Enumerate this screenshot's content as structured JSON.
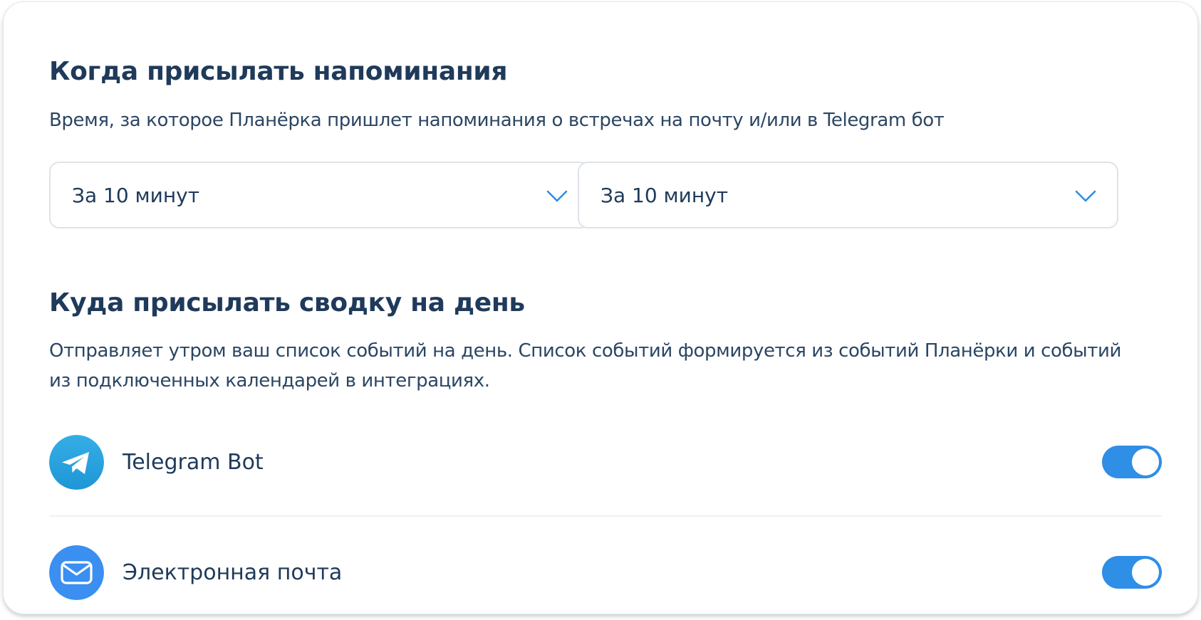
{
  "reminders": {
    "title": "Когда присылать напоминания",
    "subtitle": "Время, за которое Планёрка пришлет напоминания о встречах на почту и/или в Telegram бот",
    "selects": [
      {
        "value": "За 10 минут",
        "icon": "chevron-down-icon"
      },
      {
        "value": "За 10 минут",
        "icon": "chevron-down-icon"
      }
    ]
  },
  "digest": {
    "title": "Куда присылать сводку на день",
    "description": "Отправляет утром ваш список событий на день. Список событий формируется из событий Планёрки и событий из подключенных календарей в интеграциях.",
    "channels": [
      {
        "label": "Telegram Bot",
        "icon": "telegram-icon",
        "enabled": true
      },
      {
        "label": "Электронная почта",
        "icon": "mail-icon",
        "enabled": true
      }
    ]
  },
  "colors": {
    "heading": "#1f3a5a",
    "accent": "#2f8ee6",
    "telegram": "#2aa3de",
    "email": "#3a8ff0",
    "border": "#dfe3e8"
  }
}
